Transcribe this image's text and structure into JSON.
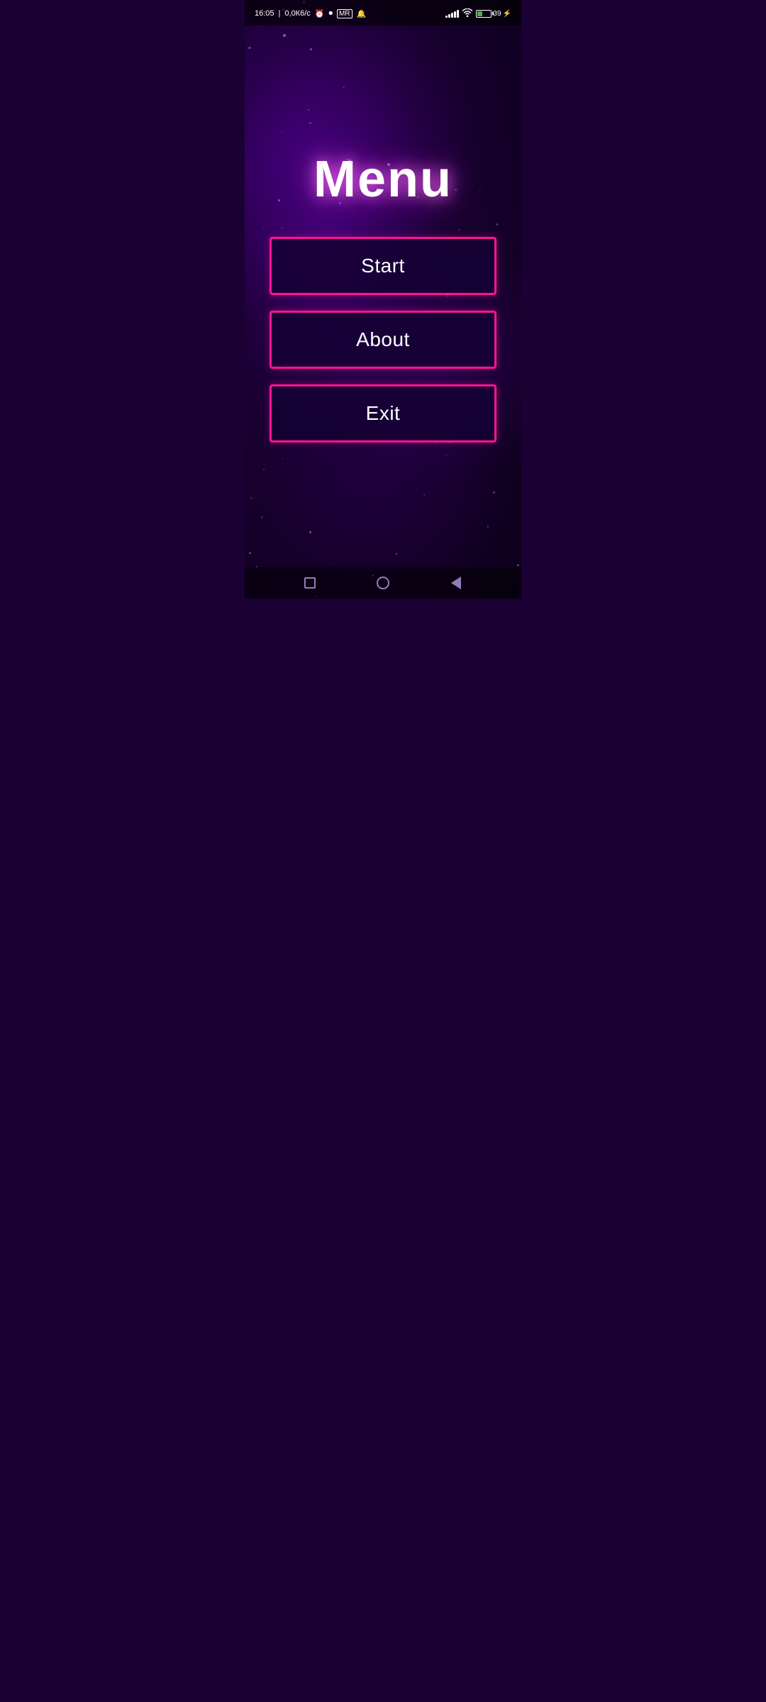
{
  "statusBar": {
    "time": "16:05",
    "dataSpeed": "0,0К6/с",
    "batteryPercent": "39",
    "batteryFillWidth": "39%"
  },
  "menu": {
    "title": "Menu",
    "buttons": [
      {
        "id": "start",
        "label": "Start"
      },
      {
        "id": "about",
        "label": "About"
      },
      {
        "id": "exit",
        "label": "Exit"
      }
    ]
  },
  "colors": {
    "neonPink": "#ff1493",
    "background": "#1a0033",
    "buttonBg": "rgba(20, 0, 50, 0.85)"
  }
}
